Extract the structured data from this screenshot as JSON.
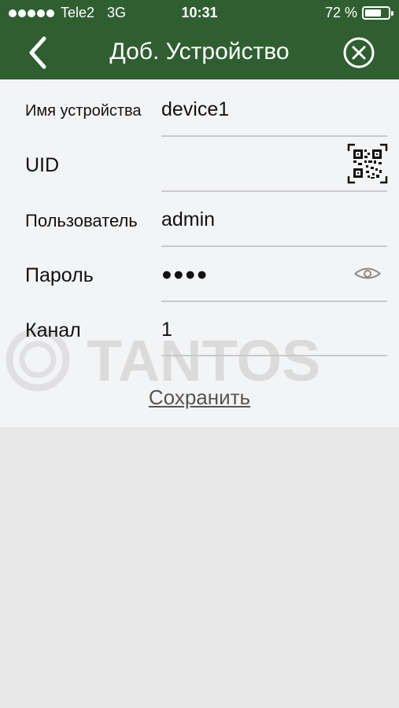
{
  "status_bar": {
    "carrier": "Tele2",
    "network": "3G",
    "time": "10:31",
    "battery": "72 %",
    "battery_level": 0.72
  },
  "nav": {
    "title": "Доб. Устройство",
    "back_icon": "chevron-left-icon",
    "close_icon": "close-circle-icon"
  },
  "form": {
    "fields": [
      {
        "label": "Имя устройства",
        "value": "device1"
      },
      {
        "label": "UID",
        "value": "",
        "icon": "qr-code-icon"
      },
      {
        "label": "Пользователь",
        "value": "admin"
      },
      {
        "label": "Пароль",
        "value": "●●●●",
        "icon": "eye-icon"
      },
      {
        "label": "Канал",
        "value": "1"
      }
    ],
    "save_label": "Сохранить"
  },
  "watermark": {
    "text": "TANTOS"
  },
  "colors": {
    "header": "#2f5f31",
    "form_bg": "#f3f4f6",
    "page_bg": "#e8e8e8",
    "line": "#c9c9c9"
  }
}
